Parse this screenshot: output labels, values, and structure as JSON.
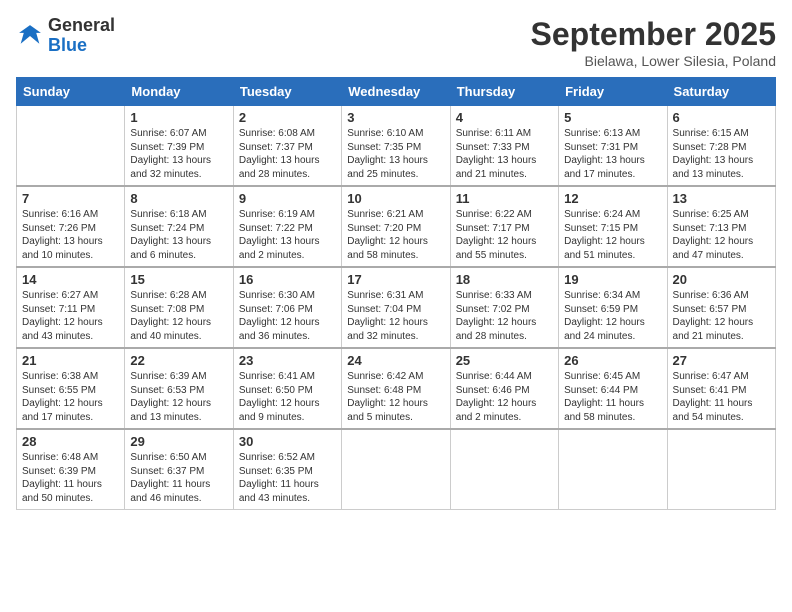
{
  "header": {
    "logo_general": "General",
    "logo_blue": "Blue",
    "month_title": "September 2025",
    "location": "Bielawa, Lower Silesia, Poland"
  },
  "days_of_week": [
    "Sunday",
    "Monday",
    "Tuesday",
    "Wednesday",
    "Thursday",
    "Friday",
    "Saturday"
  ],
  "weeks": [
    [
      {
        "day": "",
        "info": ""
      },
      {
        "day": "1",
        "info": "Sunrise: 6:07 AM\nSunset: 7:39 PM\nDaylight: 13 hours\nand 32 minutes."
      },
      {
        "day": "2",
        "info": "Sunrise: 6:08 AM\nSunset: 7:37 PM\nDaylight: 13 hours\nand 28 minutes."
      },
      {
        "day": "3",
        "info": "Sunrise: 6:10 AM\nSunset: 7:35 PM\nDaylight: 13 hours\nand 25 minutes."
      },
      {
        "day": "4",
        "info": "Sunrise: 6:11 AM\nSunset: 7:33 PM\nDaylight: 13 hours\nand 21 minutes."
      },
      {
        "day": "5",
        "info": "Sunrise: 6:13 AM\nSunset: 7:31 PM\nDaylight: 13 hours\nand 17 minutes."
      },
      {
        "day": "6",
        "info": "Sunrise: 6:15 AM\nSunset: 7:28 PM\nDaylight: 13 hours\nand 13 minutes."
      }
    ],
    [
      {
        "day": "7",
        "info": "Sunrise: 6:16 AM\nSunset: 7:26 PM\nDaylight: 13 hours\nand 10 minutes."
      },
      {
        "day": "8",
        "info": "Sunrise: 6:18 AM\nSunset: 7:24 PM\nDaylight: 13 hours\nand 6 minutes."
      },
      {
        "day": "9",
        "info": "Sunrise: 6:19 AM\nSunset: 7:22 PM\nDaylight: 13 hours\nand 2 minutes."
      },
      {
        "day": "10",
        "info": "Sunrise: 6:21 AM\nSunset: 7:20 PM\nDaylight: 12 hours\nand 58 minutes."
      },
      {
        "day": "11",
        "info": "Sunrise: 6:22 AM\nSunset: 7:17 PM\nDaylight: 12 hours\nand 55 minutes."
      },
      {
        "day": "12",
        "info": "Sunrise: 6:24 AM\nSunset: 7:15 PM\nDaylight: 12 hours\nand 51 minutes."
      },
      {
        "day": "13",
        "info": "Sunrise: 6:25 AM\nSunset: 7:13 PM\nDaylight: 12 hours\nand 47 minutes."
      }
    ],
    [
      {
        "day": "14",
        "info": "Sunrise: 6:27 AM\nSunset: 7:11 PM\nDaylight: 12 hours\nand 43 minutes."
      },
      {
        "day": "15",
        "info": "Sunrise: 6:28 AM\nSunset: 7:08 PM\nDaylight: 12 hours\nand 40 minutes."
      },
      {
        "day": "16",
        "info": "Sunrise: 6:30 AM\nSunset: 7:06 PM\nDaylight: 12 hours\nand 36 minutes."
      },
      {
        "day": "17",
        "info": "Sunrise: 6:31 AM\nSunset: 7:04 PM\nDaylight: 12 hours\nand 32 minutes."
      },
      {
        "day": "18",
        "info": "Sunrise: 6:33 AM\nSunset: 7:02 PM\nDaylight: 12 hours\nand 28 minutes."
      },
      {
        "day": "19",
        "info": "Sunrise: 6:34 AM\nSunset: 6:59 PM\nDaylight: 12 hours\nand 24 minutes."
      },
      {
        "day": "20",
        "info": "Sunrise: 6:36 AM\nSunset: 6:57 PM\nDaylight: 12 hours\nand 21 minutes."
      }
    ],
    [
      {
        "day": "21",
        "info": "Sunrise: 6:38 AM\nSunset: 6:55 PM\nDaylight: 12 hours\nand 17 minutes."
      },
      {
        "day": "22",
        "info": "Sunrise: 6:39 AM\nSunset: 6:53 PM\nDaylight: 12 hours\nand 13 minutes."
      },
      {
        "day": "23",
        "info": "Sunrise: 6:41 AM\nSunset: 6:50 PM\nDaylight: 12 hours\nand 9 minutes."
      },
      {
        "day": "24",
        "info": "Sunrise: 6:42 AM\nSunset: 6:48 PM\nDaylight: 12 hours\nand 5 minutes."
      },
      {
        "day": "25",
        "info": "Sunrise: 6:44 AM\nSunset: 6:46 PM\nDaylight: 12 hours\nand 2 minutes."
      },
      {
        "day": "26",
        "info": "Sunrise: 6:45 AM\nSunset: 6:44 PM\nDaylight: 11 hours\nand 58 minutes."
      },
      {
        "day": "27",
        "info": "Sunrise: 6:47 AM\nSunset: 6:41 PM\nDaylight: 11 hours\nand 54 minutes."
      }
    ],
    [
      {
        "day": "28",
        "info": "Sunrise: 6:48 AM\nSunset: 6:39 PM\nDaylight: 11 hours\nand 50 minutes."
      },
      {
        "day": "29",
        "info": "Sunrise: 6:50 AM\nSunset: 6:37 PM\nDaylight: 11 hours\nand 46 minutes."
      },
      {
        "day": "30",
        "info": "Sunrise: 6:52 AM\nSunset: 6:35 PM\nDaylight: 11 hours\nand 43 minutes."
      },
      {
        "day": "",
        "info": ""
      },
      {
        "day": "",
        "info": ""
      },
      {
        "day": "",
        "info": ""
      },
      {
        "day": "",
        "info": ""
      }
    ]
  ]
}
